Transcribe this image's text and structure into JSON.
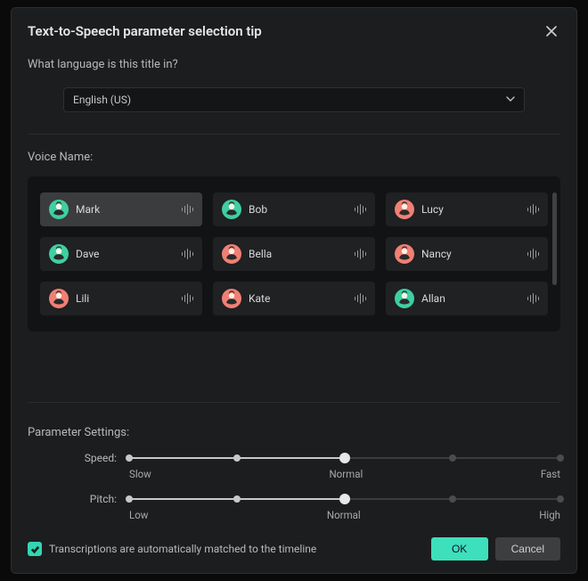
{
  "dialog": {
    "title": "Text-to-Speech parameter selection tip",
    "question": "What language is this title in?",
    "language_selected": "English (US)"
  },
  "voice": {
    "label": "Voice Name:",
    "items": [
      {
        "name": "Mark",
        "color": "#3fcfa2",
        "selected": true
      },
      {
        "name": "Bob",
        "color": "#3fcfa2",
        "selected": false
      },
      {
        "name": "Lucy",
        "color": "#f08074",
        "selected": false
      },
      {
        "name": "Dave",
        "color": "#3fcfa2",
        "selected": false
      },
      {
        "name": "Bella",
        "color": "#f08074",
        "selected": false
      },
      {
        "name": "Nancy",
        "color": "#f08074",
        "selected": false
      },
      {
        "name": "Lili",
        "color": "#f08074",
        "selected": false
      },
      {
        "name": "Kate",
        "color": "#f08074",
        "selected": false
      },
      {
        "name": "Allan",
        "color": "#3fcfa2",
        "selected": false
      }
    ]
  },
  "params": {
    "label": "Parameter Settings:",
    "speed": {
      "name": "Speed:",
      "ticks": [
        "Slow",
        "Normal",
        "Fast"
      ],
      "value_percent": 50
    },
    "pitch": {
      "name": "Pitch:",
      "ticks": [
        "Low",
        "Normal",
        "High"
      ],
      "value_percent": 50
    }
  },
  "footer": {
    "checkbox_checked": true,
    "checkbox_label": "Transcriptions are automatically matched to the timeline",
    "ok_label": "OK",
    "cancel_label": "Cancel"
  }
}
